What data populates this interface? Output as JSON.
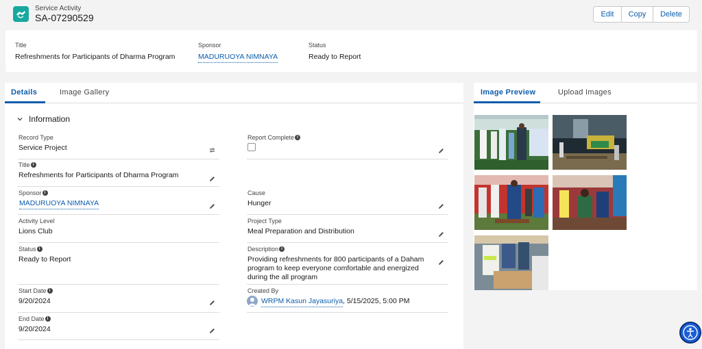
{
  "header": {
    "object_label": "Service Activity",
    "record_name": "SA-07290529",
    "icon": "service-activity-icon",
    "actions": [
      {
        "label": "Edit"
      },
      {
        "label": "Copy"
      },
      {
        "label": "Delete"
      }
    ]
  },
  "highlights": {
    "title_label": "Title",
    "title_value": "Refreshments for Participants of Dharma Program",
    "sponsor_label": "Sponsor",
    "sponsor_value": "MADURUOYA NIMNAYA",
    "status_label": "Status",
    "status_value": "Ready to Report"
  },
  "left_tabs": [
    {
      "label": "Details",
      "active": true
    },
    {
      "label": "Image Gallery",
      "active": false
    }
  ],
  "section": {
    "title": "Information"
  },
  "fields": {
    "record_type": {
      "label": "Record Type",
      "value": "Service Project"
    },
    "report_complete": {
      "label": "Report Complete",
      "checked": false
    },
    "title": {
      "label": "Title",
      "value": "Refreshments for Participants of Dharma Program"
    },
    "sponsor": {
      "label": "Sponsor",
      "value": "MADURUOYA NIMNAYA"
    },
    "cause": {
      "label": "Cause",
      "value": "Hunger"
    },
    "activity_level": {
      "label": "Activity Level",
      "value": "Lions Club"
    },
    "project_type": {
      "label": "Project Type",
      "value": "Meal Preparation and Distribution"
    },
    "status": {
      "label": "Status",
      "value": "Ready to Report"
    },
    "description": {
      "label": "Description",
      "value": "Providing refreshments for 800 participants of a Daham program to keep everyone comfortable and energized during the all program"
    },
    "start_date": {
      "label": "Start Date",
      "value": "9/20/2024"
    },
    "created_by": {
      "label": "Created By",
      "user": "WRPM Kasun Jayasuriya",
      "timestamp": ", 5/15/2025, 5:00 PM"
    },
    "end_date": {
      "label": "End Date",
      "value": "9/20/2024"
    }
  },
  "right_tabs": [
    {
      "label": "Image Preview",
      "active": true
    },
    {
      "label": "Upload Images",
      "active": false
    }
  ],
  "colors": {
    "brand_link": "#0b5cab",
    "icon_teal": "#17a8a0",
    "page_bg": "#f3f3f3"
  }
}
